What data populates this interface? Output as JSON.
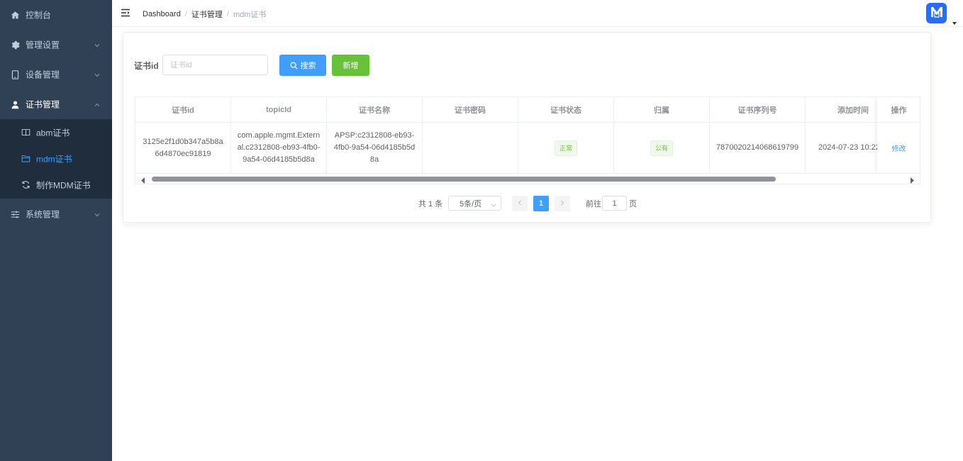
{
  "sidebar": {
    "items": [
      {
        "label": "控制台",
        "icon": "home-icon"
      },
      {
        "label": "管理设置",
        "icon": "gear-icon"
      },
      {
        "label": "设备管理",
        "icon": "tablet-icon"
      },
      {
        "label": "证书管理",
        "icon": "user-icon"
      },
      {
        "label": "系统管理",
        "icon": "sliders-icon"
      }
    ],
    "submenu": [
      {
        "label": "abm证书",
        "icon": "book-icon"
      },
      {
        "label": "mdm证书",
        "icon": "folder-icon"
      },
      {
        "label": "制作MDM证书",
        "icon": "refresh-icon"
      }
    ],
    "active_item": "证书管理",
    "active_subitem": "mdm证书"
  },
  "header": {
    "breadcrumb": [
      "Dashboard",
      "证书管理",
      "mdm证书"
    ],
    "avatar_icon": "app-logo-icon"
  },
  "search": {
    "label": "证书id",
    "placeholder": "证书id",
    "value": "",
    "search_button": "搜索",
    "add_button": "新增"
  },
  "table": {
    "columns": [
      "证书id",
      "topicId",
      "证书名称",
      "证书密码",
      "证书状态",
      "归属",
      "证书序列号",
      "添加时间",
      "操作"
    ],
    "rows": [
      {
        "cert_id": "3125e2f1d0b347a5b8a6d4870ec91819",
        "topic_id": "com.apple.mgmt.External.c2312808-eb93-4fb0-9a54-06d4185b5d8a",
        "cert_name": "APSP:c2312808-eb93-4fb0-9a54-06d4185b5d8a",
        "cert_password": "",
        "status": "正常",
        "owner": "公有",
        "serial": "7870020214068619799",
        "added_time": "2024-07-23 10:22",
        "action": "修改"
      }
    ]
  },
  "pagination": {
    "total_text": "共 1 条",
    "page_size": "5条/页",
    "current_page": "1",
    "goto_label": "前往",
    "goto_value": "1",
    "page_suffix": "页"
  },
  "colors": {
    "sidebar_bg": "#304156",
    "submenu_bg": "#1f2d3d",
    "primary": "#409eff",
    "success": "#67c23a",
    "avatar_bg": "#2a6df4"
  }
}
